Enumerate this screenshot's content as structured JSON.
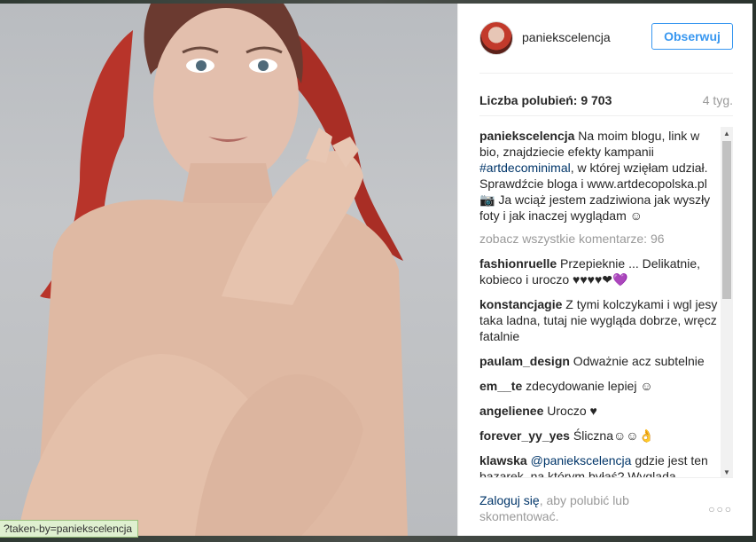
{
  "post": {
    "username": "paniekscelencja",
    "follow_label": "Obserwuj",
    "likes": "Liczba polubień: 9 703",
    "time_ago": "4 tyg.",
    "caption": {
      "user": "paniekscelencja",
      "text_1": " Na moim blogu, link w bio, znajdziecie efekty kampanii ",
      "hashtag": "#artdecominimal",
      "text_2": ", w której wzięłam udział. Sprawdźcie bloga i www.artdecopolska.pl 📷 Ja wciąż jestem zadziwiona jak wyszły foty i jak inaczej wyglądam ☺"
    },
    "view_all": "zobacz wszystkie komentarze: 96"
  },
  "comments": [
    {
      "user": "fashionruelle",
      "text": " Przepieknie ... Delikatnie, kobieco i uroczo ♥♥♥♥❤💜"
    },
    {
      "user": "konstancjagie",
      "text": " Z tymi kolczykami i wgl jesy taka ladna, tutaj nie wygląda dobrze, wręcz fatalnie"
    },
    {
      "user": "paulam_design",
      "text": " Odważnie acz subtelnie"
    },
    {
      "user": "em__te",
      "text": " zdecydowanie lepiej ☺"
    },
    {
      "user": "angelienee",
      "text": " Uroczo ♥"
    },
    {
      "user": "forever_yy_yes",
      "text": " Śliczna☺☺👌"
    },
    {
      "user": "klawska",
      "mention": "@paniekscelencja",
      "text": " gdzie jest ten bazarek, na którym byłaś? Wygląda"
    }
  ],
  "footer": {
    "login_link": "Zaloguj się",
    "login_rest": ", aby polubić lub skomentować.",
    "more": "○○○"
  },
  "status_url": "?taken-by=paniekscelencja",
  "icons": {
    "scroll_up": "scroll-up-arrow",
    "scroll_down": "scroll-down-arrow",
    "more": "more-options-icon"
  },
  "colors": {
    "link": "#003569",
    "follow": "#3897f0",
    "muted": "#999999"
  }
}
